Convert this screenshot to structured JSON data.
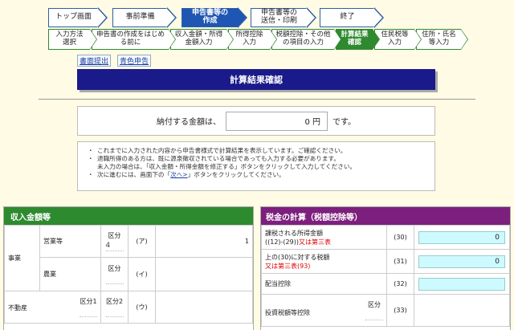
{
  "steps": [
    {
      "label": "トップ画面",
      "active": false
    },
    {
      "label": "事前準備",
      "active": false
    },
    {
      "label": "申告書等の\n作成",
      "active": true
    },
    {
      "label": "申告書等の\n送信・印刷",
      "active": false
    },
    {
      "label": "終了",
      "active": false
    }
  ],
  "substeps": [
    {
      "label": "入力方法\n選択",
      "active": false
    },
    {
      "label": "申告書の作成をはじめ\nる前に",
      "active": false
    },
    {
      "label": "収入金額・所得\n金額入力",
      "active": false
    },
    {
      "label": "所得控除\n入力",
      "active": false
    },
    {
      "label": "税額控除・その他\nの項目の入力",
      "active": false
    },
    {
      "label": "計算結果\n確認",
      "active": true
    },
    {
      "label": "住民税等\n入力",
      "active": false
    },
    {
      "label": "住所・氏名\n等入力",
      "active": false
    }
  ],
  "links": {
    "shomen": "書面提出",
    "aoiro": "青色申告"
  },
  "title": "計算結果確認",
  "amount": {
    "prefix": "納付する金額は、",
    "value": "0 円",
    "suffix": "です。"
  },
  "notes": {
    "bullet": "・",
    "line1": "これまでに入力された内容から申告書様式で計算結果を表示しています。ご確認ください。",
    "line2": "退職所得のある方は、既に源泉徴収されている場合であっても入力する必要があります。",
    "line3": "未入力の場合は、「収入金額・所得金額を修正する」ボタンをクリックして入力してください。",
    "line4_pre": "次に進むには、画面下の「",
    "line4_link": "次へ>",
    "line4_post": "」ボタンをクリックしてください。"
  },
  "income": {
    "header": "収入金額等",
    "jigyo": "事業",
    "eigyo": "営業等",
    "nogyo": "農業",
    "fudosan": "不動産",
    "kubun": "区分",
    "kubun1": "区分1",
    "kubun2": "区分2",
    "eigyo_kubun": "4",
    "code_a": "(ア)",
    "code_i": "(イ)",
    "code_u": "(ウ)",
    "eigyo_value": "1"
  },
  "tax": {
    "header": "税金の計算（税額控除等）",
    "rows": [
      {
        "label": "課税される所得金額",
        "label2": "((12)-(29))",
        "red": "又は第三表",
        "code": "(30)",
        "value": "0"
      },
      {
        "label": "上の(30)に対する税額",
        "label2": "",
        "red": "又は第三表(93)",
        "code": "(31)",
        "value": "0"
      },
      {
        "label": "配当控除",
        "label2": "",
        "red": "",
        "code": "(32)",
        "value": ""
      },
      {
        "label": "投資税額等控除",
        "label2": "",
        "red": "",
        "code": "(33)",
        "value": "",
        "kubun": "区分"
      }
    ]
  },
  "colors": {
    "active_step": "#1f56b3",
    "sub_active": "#2f8a2f",
    "title_bg": "#1a1a8a",
    "income_head": "#2e8a2e",
    "tax_head": "#7d1f7d",
    "input_fill": "#cdfaff"
  }
}
